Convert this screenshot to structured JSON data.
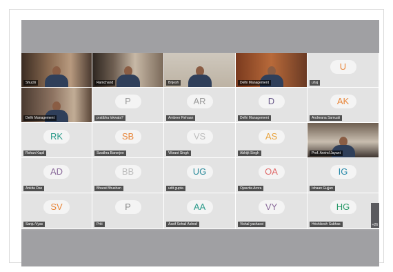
{
  "participants": [
    {
      "name": "Shuchi",
      "video": true
    },
    {
      "name": "Ramchand",
      "video": true
    },
    {
      "name": "Brijesh",
      "video": true
    },
    {
      "name": "Delhi Management",
      "video": true
    },
    {
      "name": "uhsj",
      "initials": "U",
      "color": "#e8863a"
    },
    {
      "name": "Delhi Management",
      "video": true
    },
    {
      "name": "pratibha lokwala?",
      "initials": "P",
      "color": "#9a9a9a"
    },
    {
      "name": "Ambeer Rehaan",
      "initials": "AR",
      "color": "#9a9a9a"
    },
    {
      "name": "Delhi Management",
      "initials": "D",
      "color": "#6a5a8a"
    },
    {
      "name": "Andreana Samuali",
      "initials": "AK",
      "color": "#e8863a"
    },
    {
      "name": "Rohan Kapil",
      "initials": "RK",
      "color": "#2a9a8a"
    },
    {
      "name": "Swathra Banerjee",
      "initials": "SB",
      "color": "#e8863a"
    },
    {
      "name": "Vikrant Singh",
      "initials": "VS",
      "color": "#bdbdbd"
    },
    {
      "name": "Abhijit Singh",
      "initials": "AS",
      "color": "#e8a23a"
    },
    {
      "name": "Prof. Arvind Jayant",
      "video": true
    },
    {
      "name": "Ankita Das",
      "initials": "AD",
      "color": "#8a6a9a"
    },
    {
      "name": "Bharat Bhushan",
      "initials": "BB",
      "color": "#bdbdbd"
    },
    {
      "name": "udit gupta",
      "initials": "UG",
      "color": "#2a8a9a"
    },
    {
      "name": "Ojasvita Arora",
      "initials": "OA",
      "color": "#e06a6a"
    },
    {
      "name": "Ishaan Gujjan",
      "initials": "IG",
      "color": "#2a8aaa"
    },
    {
      "name": "Sanju Vyas",
      "initials": "SV",
      "color": "#e8863a"
    },
    {
      "name": "Priti",
      "initials": "P",
      "color": "#8a8a8a"
    },
    {
      "name": "Aasif Sohail Ashraf",
      "initials": "AA",
      "color": "#2a9a8a"
    },
    {
      "name": "Vishal yashasvi",
      "initials": "VY",
      "color": "#8a6a9a"
    },
    {
      "name": "Hrishikesh Subhas",
      "initials": "HG",
      "color": "#2a9a6a"
    }
  ],
  "overflow_label": "+26"
}
